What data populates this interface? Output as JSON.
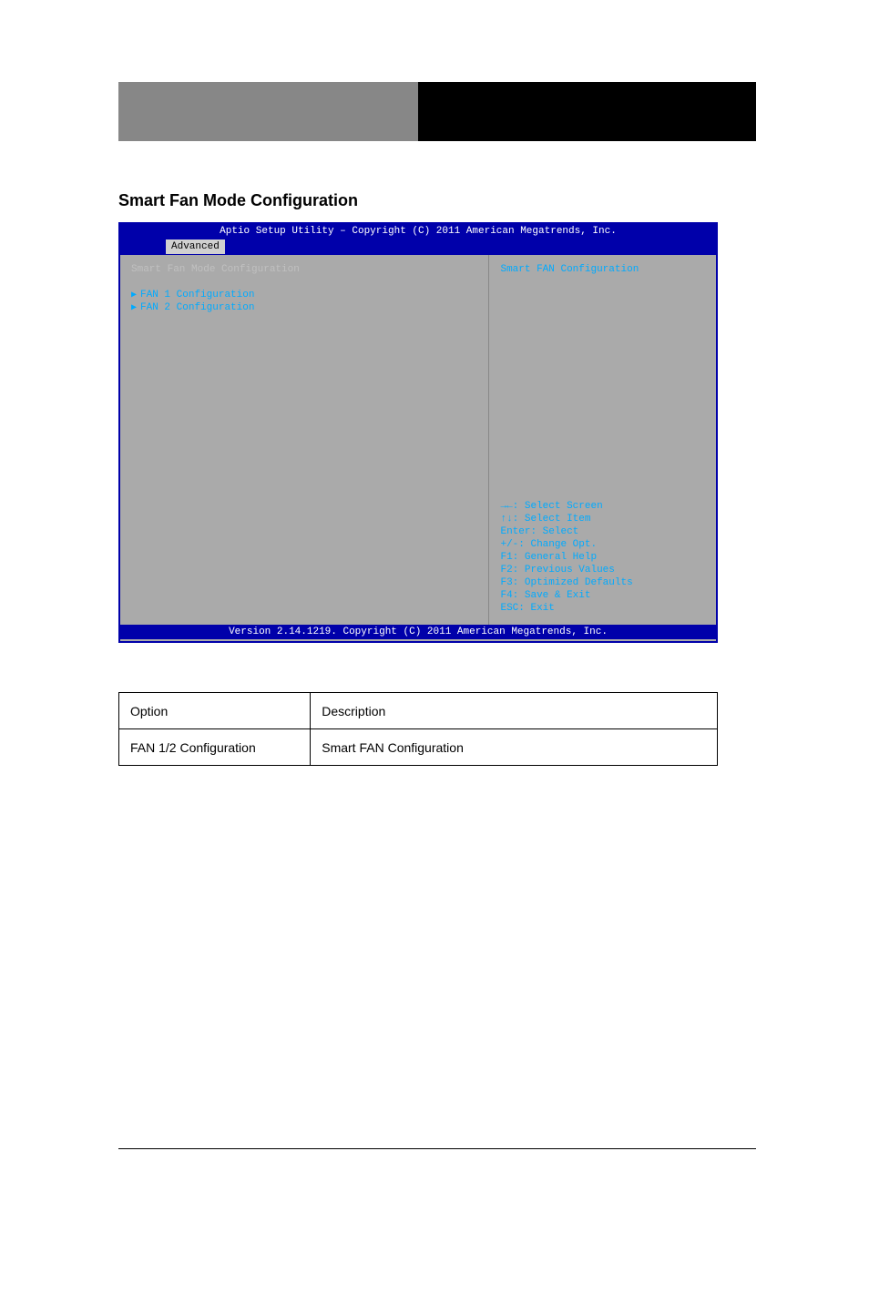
{
  "heading": "Smart Fan Mode Configuration",
  "bios": {
    "title": "Aptio Setup Utility – Copyright (C) 2011 American Megatrends, Inc.",
    "tab": "Advanced",
    "left_title": "Smart Fan Mode Configuration",
    "menu_items": [
      "FAN 1 Configuration",
      "FAN 2 Configuration"
    ],
    "help_title": "Smart FAN Configuration",
    "help_lines": [
      "→←: Select Screen",
      "↑↓: Select Item",
      "Enter: Select",
      "+/-: Change Opt.",
      "F1: General Help",
      "F2: Previous Values",
      "F3: Optimized Defaults",
      "F4: Save & Exit",
      "ESC: Exit"
    ],
    "footer": "Version 2.14.1219. Copyright (C) 2011 American Megatrends, Inc."
  },
  "table": {
    "headers": [
      "Option",
      "Description"
    ],
    "rows": [
      [
        "FAN 1/2 Configuration",
        "Smart FAN Configuration"
      ]
    ]
  }
}
